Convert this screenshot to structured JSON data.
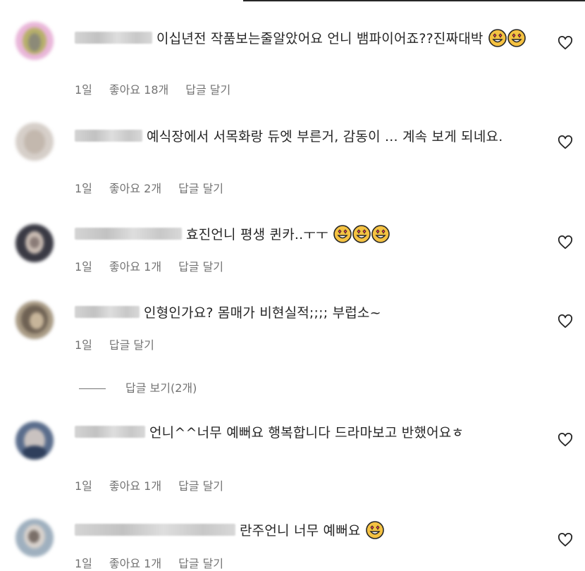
{
  "comments": [
    {
      "text": "이십년전 작품보는줄알았어요 언니 뱀파이어죠??진짜대박",
      "emoji_count": 2,
      "time": "1일",
      "likes": "좋아요 18개",
      "reply": "답글 달기"
    },
    {
      "text": "예식장에서 서목화랑 듀엣 부른거, 감동이 ... 계속 보게 되네요.",
      "emoji_count": 0,
      "time": "1일",
      "likes": "좋아요 2개",
      "reply": "답글 달기"
    },
    {
      "text": "효진언니 평생 퀸카..ㅜㅜ",
      "emoji_count": 3,
      "time": "1일",
      "likes": "좋아요 1개",
      "reply": "답글 달기"
    },
    {
      "text": "인형인가요? 몸매가 비현실적;;;; 부럽소~",
      "emoji_count": 0,
      "time": "1일",
      "likes": "",
      "reply": "답글 달기"
    },
    {
      "text": "언니^^너무 예뻐요 행복합니다 드라마보고 반했어요ㅎ",
      "emoji_count": 0,
      "time": "1일",
      "likes": "좋아요 1개",
      "reply": "답글 달기"
    },
    {
      "text": "란주언니 너무 예뻐요",
      "emoji_count": 1,
      "time": "1일",
      "likes": "좋아요 1개",
      "reply": "답글 달기"
    }
  ],
  "view_replies": "답글 보기(2개)",
  "icons": {
    "like": "heart-icon",
    "reaction": "heart-eyes-emoji"
  },
  "colors": {
    "text": "#262626",
    "meta": "#737373",
    "emoji_face": "#f5c242",
    "emoji_heart": "#e8364a"
  }
}
